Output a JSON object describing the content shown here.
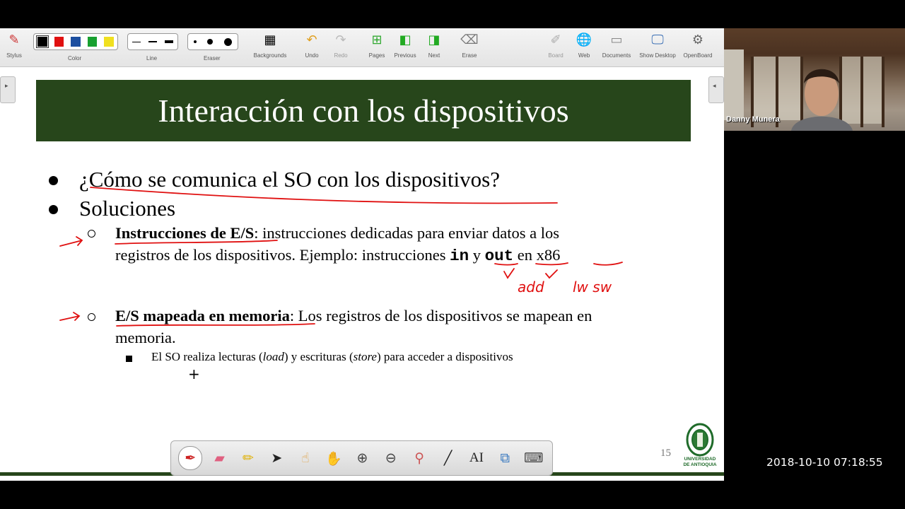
{
  "toolbar": {
    "stylus": "Stylus",
    "color": "Color",
    "line": "Line",
    "eraser": "Eraser",
    "backgrounds": "Backgrounds",
    "undo": "Undo",
    "redo": "Redo",
    "pages": "Pages",
    "previous": "Previous",
    "next": "Next",
    "erase": "Erase",
    "board": "Board",
    "web": "Web",
    "documents": "Documents",
    "show_desktop": "Show Desktop",
    "openboard": "OpenBoard",
    "colors": [
      "#000000",
      "#e01010",
      "#1d4fa0",
      "#18a030",
      "#f0e020"
    ]
  },
  "slide": {
    "title": "Interacción con los dispositivos",
    "bullet1": "¿Cómo se comunica el SO con los dispositivos?",
    "bullet2": "Soluciones",
    "sub1_bold": "Instrucciones de E/S",
    "sub1_rest": ": instrucciones dedicadas para enviar datos a los",
    "sub1_line2_a": "registros de los dispositivos. Ejemplo: instrucciones ",
    "sub1_in": "in",
    "sub1_y": " y ",
    "sub1_out": "out",
    "sub1_en": " en ",
    "sub1_x86": "x86",
    "sub2_bold": "E/S mapeada en memoria",
    "sub2_rest": ": Los registros de los dispositivos se mapean en",
    "sub2_line2": "memoria.",
    "subsub_a": "El SO realiza lecturas (",
    "subsub_load": "load",
    "subsub_b": ") y escrituras (",
    "subsub_store": "store",
    "subsub_c": ") para acceder a dispositivos",
    "page_number": "15",
    "logo_line1": "UNIVERSIDAD",
    "logo_line2": "DE ANTIOQUIA"
  },
  "annotations": {
    "handwriting1": "add",
    "handwriting2": "lw sw",
    "accent_color": "#e01010"
  },
  "webcam": {
    "name": "Danny Munera"
  },
  "timestamp": "2018-10-10 07:18:55"
}
